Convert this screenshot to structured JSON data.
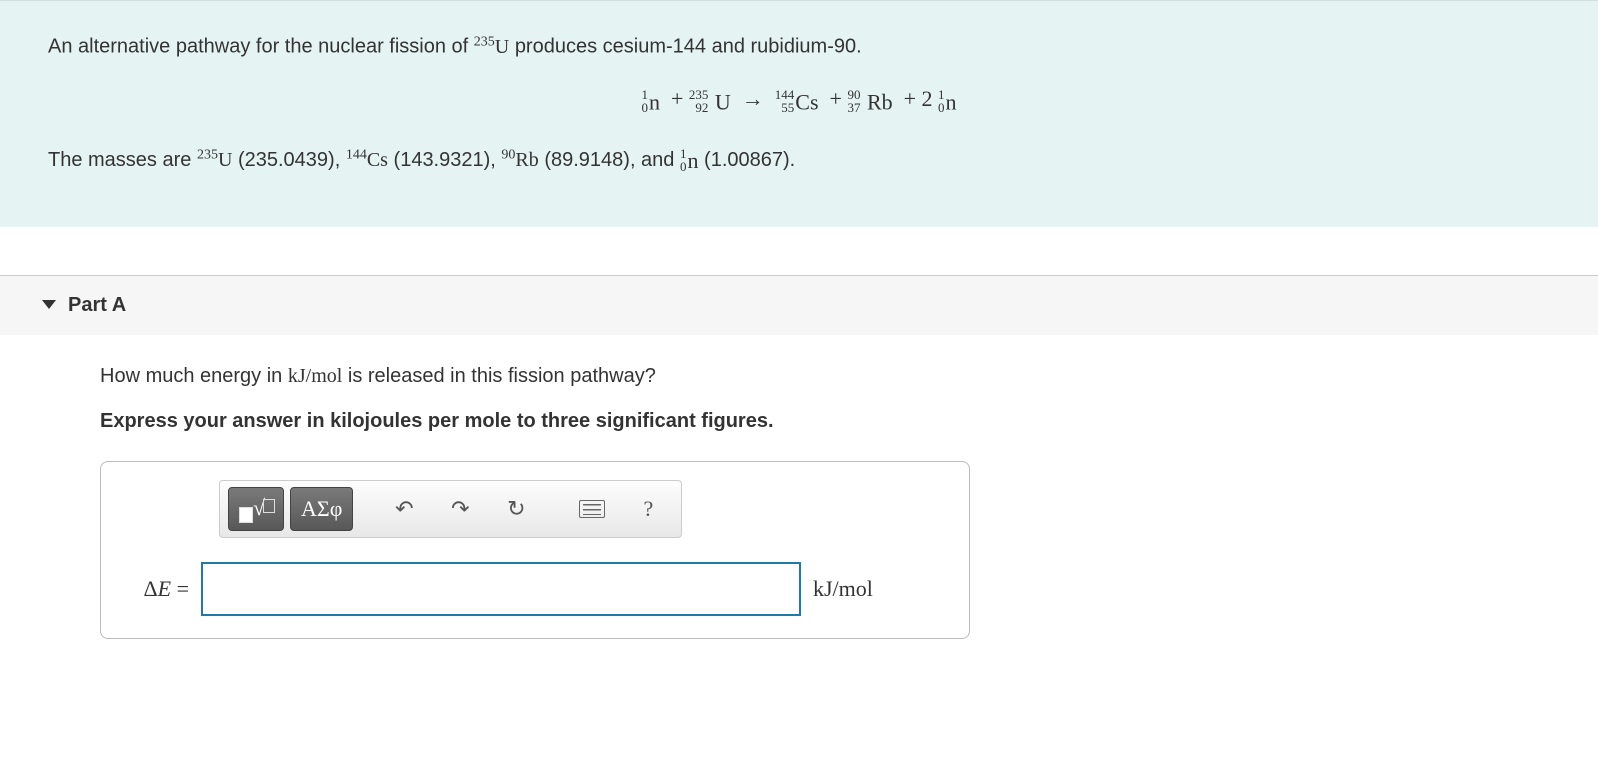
{
  "problem": {
    "intro_prefix": "An alternative pathway for the nuclear fission of ",
    "intro_suffix": " produces cesium-144 and rubidium-90.",
    "equation": {
      "n1": {
        "top": "1",
        "bot": "0",
        "sym": "n"
      },
      "u": {
        "top": "235",
        "bot": "92",
        "sym": "U"
      },
      "cs": {
        "top": "144",
        "bot": "55",
        "sym": "Cs"
      },
      "rb": {
        "top": "90",
        "bot": "37",
        "sym": "Rb"
      },
      "n2": {
        "coef": "2",
        "top": "1",
        "bot": "0",
        "sym": "n"
      }
    },
    "masses_prefix": "The masses are ",
    "masses": {
      "u": {
        "sup": "235",
        "sym": "U",
        "val": "(235.0439)"
      },
      "cs": {
        "sup": "144",
        "sym": "Cs",
        "val": "(143.9321)"
      },
      "rb": {
        "sup": "90",
        "sym": "Rb",
        "val": "(89.9148)"
      },
      "n": {
        "top": "1",
        "bot": "0",
        "sym": "n",
        "val": "(1.00867)"
      }
    },
    "masses_and": ", and ",
    "masses_end": "."
  },
  "part": {
    "label": "Part A",
    "question_prefix": "How much energy in ",
    "question_unit": "kJ/mol",
    "question_suffix": " is released in this fission pathway?",
    "instruction": "Express your answer in kilojoules per mole to three significant figures."
  },
  "toolbar": {
    "greek": "ΑΣφ",
    "undo": "↶",
    "redo": "↷",
    "reset": "↻",
    "help": "?"
  },
  "answer": {
    "prefix": "ΔE =",
    "value": "",
    "unit": "kJ/mol"
  }
}
